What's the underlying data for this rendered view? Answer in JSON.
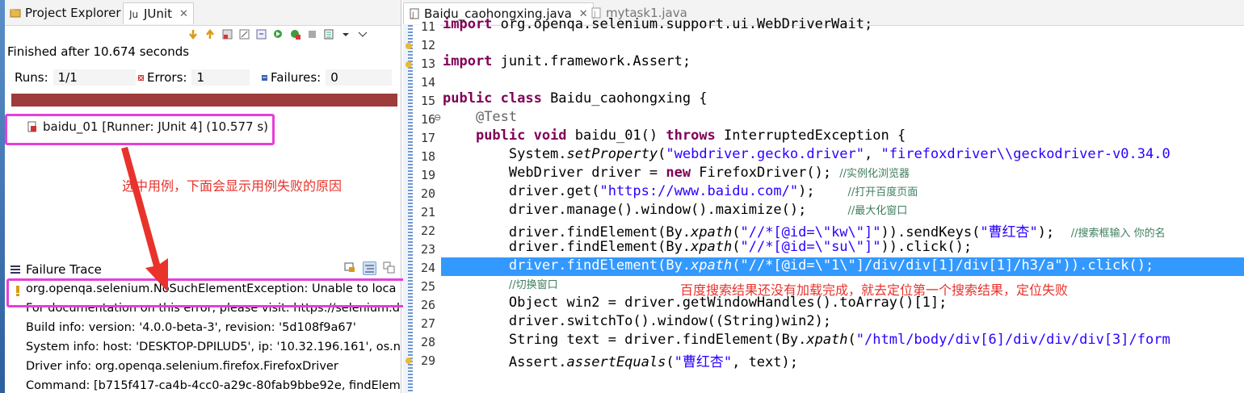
{
  "left_panel": {
    "tabs": [
      {
        "label": "Project Explorer"
      },
      {
        "label": "JUnit",
        "close": "✕"
      }
    ],
    "status": "Finished after 10.674 seconds",
    "runs_label": "Runs:",
    "runs_value": "1/1",
    "errors_label": "Errors:",
    "errors_value": "1",
    "failures_label": "Failures:",
    "failures_value": "0",
    "test_item": "baidu_01 [Runner: JUnit 4] (10.577 s)",
    "annotation": "选中用例，下面会显示用例失败的原因",
    "failure_trace_title": "Failure Trace",
    "trace_lines": [
      "org.openqa.selenium.NoSuchElementException: Unable to loca",
      "For documentation on this error, please visit: https://selenium.d",
      "Build info: version: '4.0.0-beta-3', revision: '5d108f9a67'",
      "System info: host: 'DESKTOP-DPILUD5', ip: '10.32.196.161', os.na",
      "Driver info: org.openqa.selenium.firefox.FirefoxDriver",
      "Command: [b715f417-ca4b-4cc0-a29c-80fab9bbe92e, findElem"
    ],
    "progress_color": "#9e3b3b"
  },
  "editor": {
    "tabs": [
      {
        "label": "Baidu_caohongxing.java",
        "close": "✕"
      },
      {
        "label": "mytask1.java"
      }
    ],
    "line_numbers": [
      "11",
      "12",
      "13",
      "14",
      "15",
      "16",
      "17",
      "18",
      "19",
      "20",
      "21",
      "22",
      "23",
      "24",
      "25",
      "26",
      "27",
      "28",
      "29"
    ],
    "line_12_marker": "⊖",
    "line_16_marker": "⊖",
    "annotation": "百度搜索结果还没有加载完成，就去定位第一个搜索结果，定位失败",
    "highlight_color": "#3399ff"
  }
}
